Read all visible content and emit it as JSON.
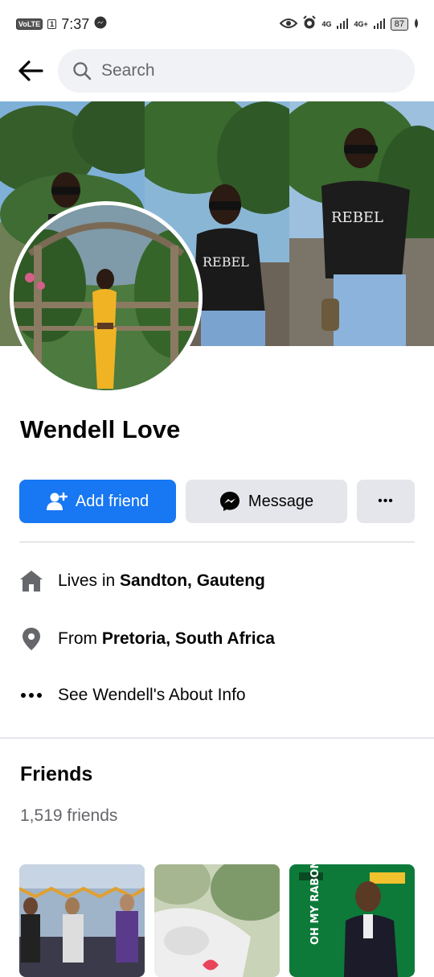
{
  "status_bar": {
    "volte": "VoLTE",
    "sim": "1",
    "time": "7:37",
    "net1": "4G",
    "net2": "4G+",
    "battery": "87"
  },
  "search": {
    "placeholder": "Search"
  },
  "profile": {
    "name": "Wendell Love"
  },
  "actions": {
    "add_friend": "Add friend",
    "message": "Message",
    "more": "•••"
  },
  "info": {
    "lives_prefix": "Lives in ",
    "lives_place": "Sandton, Gauteng",
    "from_prefix": "From ",
    "from_place": "Pretoria, South Africa",
    "about": "See Wendell's About Info"
  },
  "friends": {
    "title": "Friends",
    "count": "1,519 friends"
  },
  "colors": {
    "accent": "#1877f2",
    "button_gray": "#e4e6eb",
    "muted": "#65676b"
  }
}
